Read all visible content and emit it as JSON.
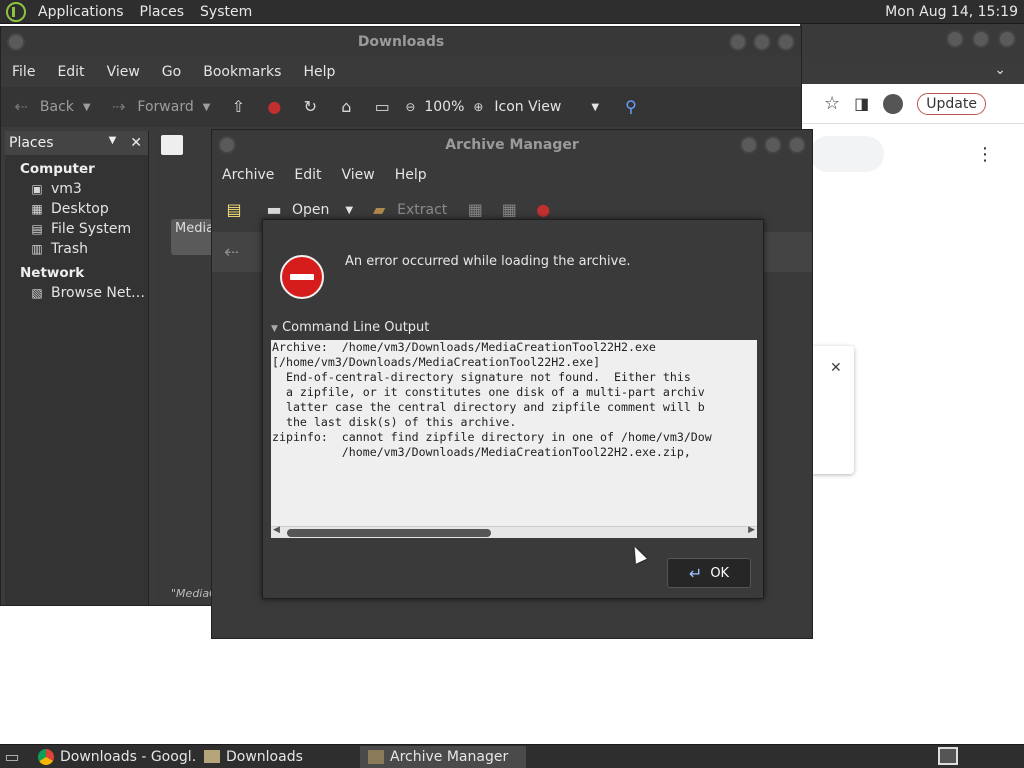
{
  "top_panel": {
    "menus": [
      "Applications",
      "Places",
      "System"
    ],
    "clock": "Mon Aug 14, 15:19"
  },
  "chrome": {
    "update_label": "Update"
  },
  "file_manager": {
    "title": "Downloads",
    "menu": [
      "File",
      "Edit",
      "View",
      "Go",
      "Bookmarks",
      "Help"
    ],
    "toolbar": {
      "back": "Back",
      "forward": "Forward",
      "zoom": "100%",
      "view_mode": "Icon View"
    },
    "sidebar": {
      "header": "Places",
      "section_computer": "Computer",
      "computer_items": [
        "vm3",
        "Desktop",
        "File System",
        "Trash"
      ],
      "section_network": "Network",
      "network_items": [
        "Browse Net…"
      ]
    },
    "tile_label": "Media",
    "status": "\"MediaC"
  },
  "archive_manager": {
    "title": "Archive Manager",
    "menu": [
      "Archive",
      "Edit",
      "View",
      "Help"
    ],
    "toolbar": {
      "open": "Open",
      "extract": "Extract"
    }
  },
  "error_dialog": {
    "message": "An error occurred while loading the archive.",
    "expander": "Command Line Output",
    "output": "Archive:  /home/vm3/Downloads/MediaCreationTool22H2.exe\n[/home/vm3/Downloads/MediaCreationTool22H2.exe]\n  End-of-central-directory signature not found.  Either this\n  a zipfile, or it constitutes one disk of a multi-part archiv\n  latter case the central directory and zipfile comment will b\n  the last disk(s) of this archive.\nzipinfo:  cannot find zipfile directory in one of /home/vm3/Dow\n          /home/vm3/Downloads/MediaCreationTool22H2.exe.zip,",
    "ok_label": "OK"
  },
  "taskbar": {
    "tasks": [
      "Downloads - Googl…",
      "Downloads",
      "Archive Manager"
    ]
  },
  "colors": {
    "error_red": "#d71c1c",
    "panel_bg": "#2e2e2e",
    "window_bg": "#3a3a3a"
  }
}
